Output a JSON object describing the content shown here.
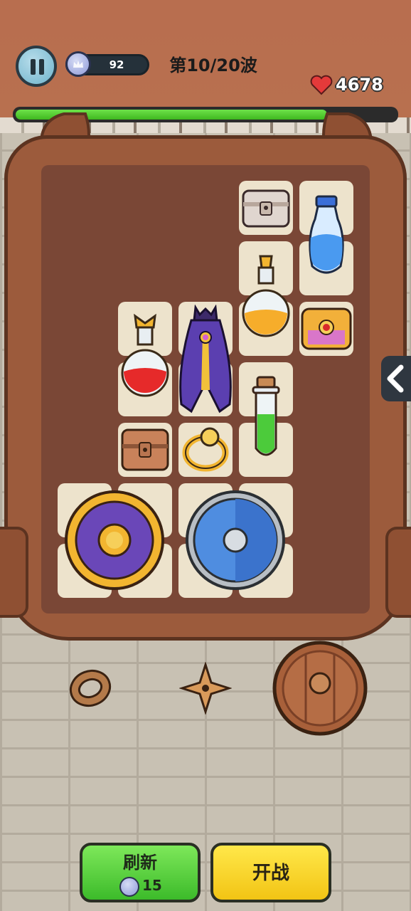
{
  "hud": {
    "gems": "92",
    "wave": "第10/20波",
    "hp": "4678",
    "hp_fraction": 0.82
  },
  "inventory": {
    "items": [
      {
        "name": "treasure-chest-silver-icon"
      },
      {
        "name": "blue-potion-icon"
      },
      {
        "name": "orange-potion-icon"
      },
      {
        "name": "ornate-chest-icon"
      },
      {
        "name": "red-potion-icon"
      },
      {
        "name": "purple-cape-icon"
      },
      {
        "name": "green-potion-icon"
      },
      {
        "name": "wooden-chest-icon"
      },
      {
        "name": "gold-ring-icon"
      },
      {
        "name": "purple-shield-icon"
      },
      {
        "name": "blue-shield-icon"
      }
    ]
  },
  "shop": {
    "items": [
      {
        "name": "wooden-ring-icon"
      },
      {
        "name": "shuriken-icon"
      },
      {
        "name": "wooden-shield-icon"
      }
    ]
  },
  "buttons": {
    "refresh_label": "刷新",
    "refresh_cost": "15",
    "battle_label": "开战"
  },
  "colors": {
    "hp_bar": "#4fcf2e",
    "refresh_button": "#5fd43d",
    "battle_button": "#f8d52a",
    "backpack": "#9c5b3c"
  }
}
